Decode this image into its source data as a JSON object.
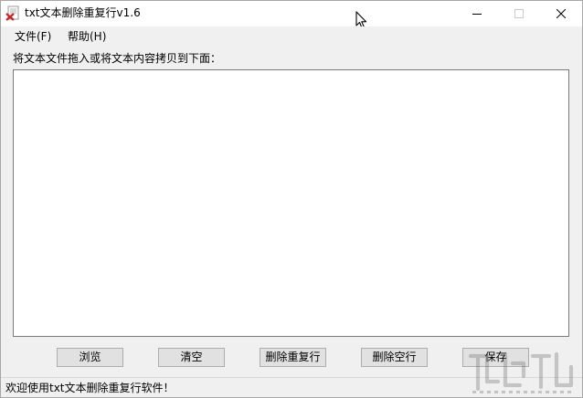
{
  "window": {
    "title": "txt文本删除重复行v1.6",
    "controls": {
      "minimize_icon": "minimize-icon",
      "maximize_icon": "maximize-icon",
      "close_icon": "close-icon"
    }
  },
  "menu": {
    "items": [
      {
        "label": "文件(F)"
      },
      {
        "label": "帮助(H)"
      }
    ]
  },
  "main": {
    "instruction": "将文本文件拖入或将文本内容拷贝到下面：",
    "textarea_value": ""
  },
  "buttons": {
    "browse": "浏览",
    "clear": "清空",
    "remove_duplicates": "删除重复行",
    "remove_blank": "删除空行",
    "save": "保存"
  },
  "status": {
    "text": "欢迎使用txt文本删除重复行软件！"
  },
  "colors": {
    "window_bg": "#f0f0f0",
    "titlebar_bg": "#ffffff",
    "textarea_bg": "#ffffff",
    "button_bg": "#e1e1e1",
    "button_border": "#adadad"
  }
}
